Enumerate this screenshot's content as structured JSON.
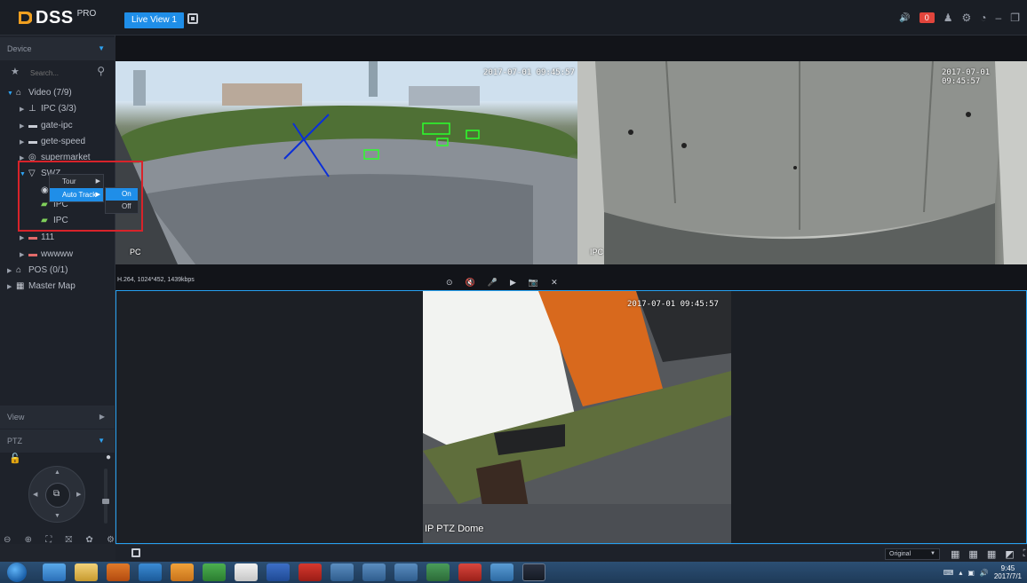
{
  "app": {
    "brand": "DSS",
    "edition": "PRO"
  },
  "tabs": {
    "live_view": "Live View 1"
  },
  "topbar": {
    "alarm_count": "0"
  },
  "sidebar": {
    "device_header": "Device",
    "search_placeholder": "Search...",
    "tree": {
      "video": "Video (7/9)",
      "ipc_group": "IPC (3/3)",
      "gate_ipc": "gate-ipc",
      "gete_speed": "gete-speed",
      "supermarket": "supermarket",
      "swz": "SWZ",
      "ipc_child_2": "IPC",
      "ipc_child_3": "IPC",
      "node_111": "111",
      "wwwww": "wwwww",
      "pos": "POS (0/1)",
      "master_map": "Master Map"
    },
    "view_header": "View",
    "ptz_header": "PTZ"
  },
  "context_menu": {
    "tour": "Tour",
    "auto_track": "Auto Track",
    "on": "On",
    "off": "Off"
  },
  "video": {
    "cell1_timestamp": "2017-07-01 09:45:57",
    "cell1_label": "PC",
    "cell2_timestamp": "2017-07-01 09:45:57",
    "cell2_label": "IPC",
    "stream_info": "H.264, 1024*452, 1439kbps",
    "cell3_timestamp": "2017-07-01 09:45:57",
    "cell3_label": "IP PTZ Dome"
  },
  "bottombar": {
    "scale_option": "Original"
  },
  "taskbar": {
    "time": "9:45",
    "date": "2017/7/1"
  },
  "colors": {
    "accent": "#1f8ee8",
    "highlight_box": "#d8232a",
    "alarm": "#e2453c"
  }
}
